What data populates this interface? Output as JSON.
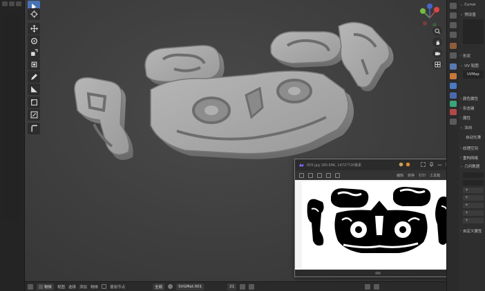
{
  "header": {
    "object_name": "Curve"
  },
  "toolbar": {
    "tools": [
      "select-cursor",
      "cursor",
      "move",
      "rotate",
      "scale",
      "transform",
      "annotate",
      "measure",
      "add-cube",
      "extrude",
      "curve-tilt"
    ],
    "active_index": 0,
    "accent": "#4772b3"
  },
  "viewer": {
    "title": "005.jpg   180.69K, 1472*720像素",
    "zoom_menu": "编辑",
    "convert_menu": "转换",
    "print_label": "打印",
    "tools_label": "工具箱"
  },
  "statusbar": {
    "mode": "物体",
    "view": "视图",
    "select": "选择",
    "add": "添加",
    "object": "物体",
    "global_label": "使用节点",
    "orientation": "全局",
    "material": "SVGMat.001",
    "count": "21"
  },
  "properties": {
    "preset_label": "预设值",
    "shape_label": "形状",
    "uv_label": "UV 贴图",
    "uv_map_name": "UVMap",
    "color_attr_label": "颜色属性",
    "shapekeys_label": "形态键",
    "attributes_label": "属性",
    "normals_label": "法向",
    "auto_smooth_label": "自动光滑",
    "texture_space_label": "纹理空间",
    "remesh_label": "重构网格",
    "geometry_data_label": "几何数据",
    "custom_props_label": "自定义属性"
  }
}
